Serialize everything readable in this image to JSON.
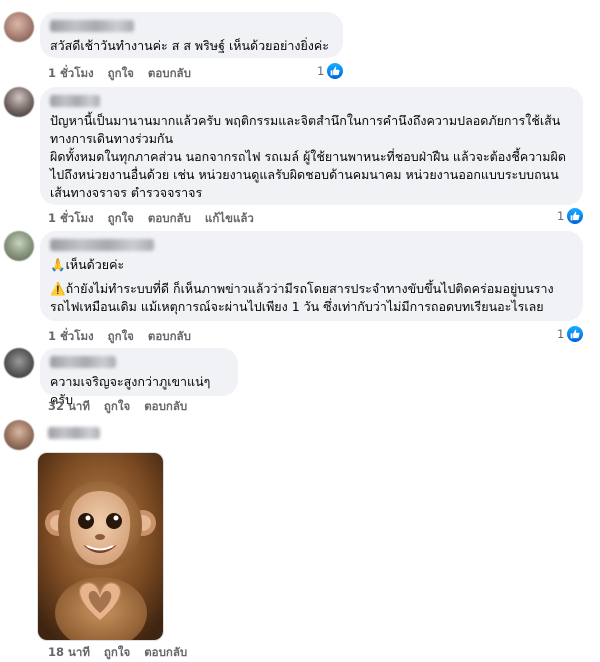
{
  "comments": [
    {
      "text": "สวัสดีเช้าวันทำงานค่ะ ส ส พริษฐ์ เห็นด้วยอย่างยิ่งค่ะ",
      "time": "1 ชั่วโมง",
      "like_label": "ถูกใจ",
      "reply_label": "ตอบกลับ",
      "reaction_count": "1"
    },
    {
      "text": "ปัญหานี้เป็นมานานมากแล้วครับ พฤติกรรมและจิตสำนึกในการคำนึงถึงความปลอดภัยการใช้เส้นทางการเดินทางร่วมกัน\nผิดทั้งหมดในทุกภาคส่วน นอกจากรถไฟ รถเมล์ ผู้ใช้ยานพาหนะที่ชอบฝ่าฝืน แล้วจะต้องชี้ความผิดไปถึงหน่วยงานอื่นด้วย เช่น หน่วยงานดูแลรับผิดชอบด้านคมนาคม หน่วยงานออกแบบระบบถนนเส้นทางจราจร ตำรวจจราจร",
      "time": "1 ชั่วโมง",
      "like_label": "ถูกใจ",
      "reply_label": "ตอบกลับ",
      "edited_label": "แก้ไขแล้ว",
      "reaction_count": "1"
    },
    {
      "line1_icon": "🙏",
      "line1": "เห็นด้วยค่ะ",
      "line2_icon": "⚠️",
      "line2": "ถ้ายังไม่ทำระบบที่ดี ก็เห็นภาพข่าวแล้วว่ามีรถโดยสารประจำทางขับขึ้นไปติดคร่อมอยู่บนรางรถไฟเหมือนเดิม แม้เหตุการณ์จะผ่านไปเพียง 1 วัน ซึ่งเท่ากับว่าไม่มีการถอดบทเรียนอะไรเลย",
      "time": "1 ชั่วโมง",
      "like_label": "ถูกใจ",
      "reply_label": "ตอบกลับ",
      "reaction_count": "1"
    },
    {
      "text": "ความเจริญจะสูงกว่าภูเขาแน่ๆครับ",
      "time": "32 นาที",
      "like_label": "ถูกใจ",
      "reply_label": "ตอบกลับ"
    },
    {
      "time": "18 นาที",
      "like_label": "ถูกใจ",
      "reply_label": "ตอบกลับ"
    }
  ],
  "colors": {
    "bubble": "#f0f2f5",
    "meta_text": "#65676b",
    "like_blue": "#0866ff"
  }
}
